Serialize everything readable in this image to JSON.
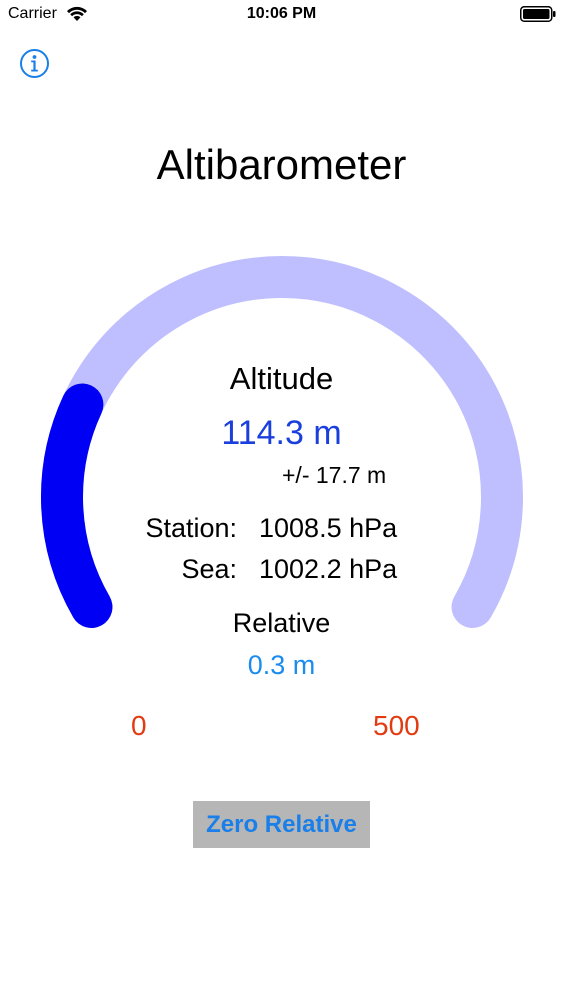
{
  "status_bar": {
    "carrier": "Carrier",
    "time": "10:06 PM",
    "wifi_icon": "wifi-icon",
    "battery_icon": "battery-icon"
  },
  "header": {
    "info_icon": "info-icon",
    "title": "Altibarometer"
  },
  "gauge": {
    "min_label": "0",
    "max_label": "500",
    "min": 0,
    "max": 500,
    "value": 114.3,
    "track_color": "#bfbfff",
    "fill_color": "#0000f5",
    "scale_label_color": "#e23b12"
  },
  "readout": {
    "altitude_label": "Altitude",
    "altitude_value": "114.3 m",
    "accuracy": "+/- 17.7 m",
    "station_label": "Station:",
    "station_value": "1008.5 hPa",
    "sea_label": "Sea:",
    "sea_value": "1002.2 hPa",
    "relative_label": "Relative",
    "relative_value": "0.3 m",
    "altitude_color": "#1a3fdc",
    "relative_color": "#1a8cf0"
  },
  "actions": {
    "zero_relative_label": "Zero Relative"
  }
}
